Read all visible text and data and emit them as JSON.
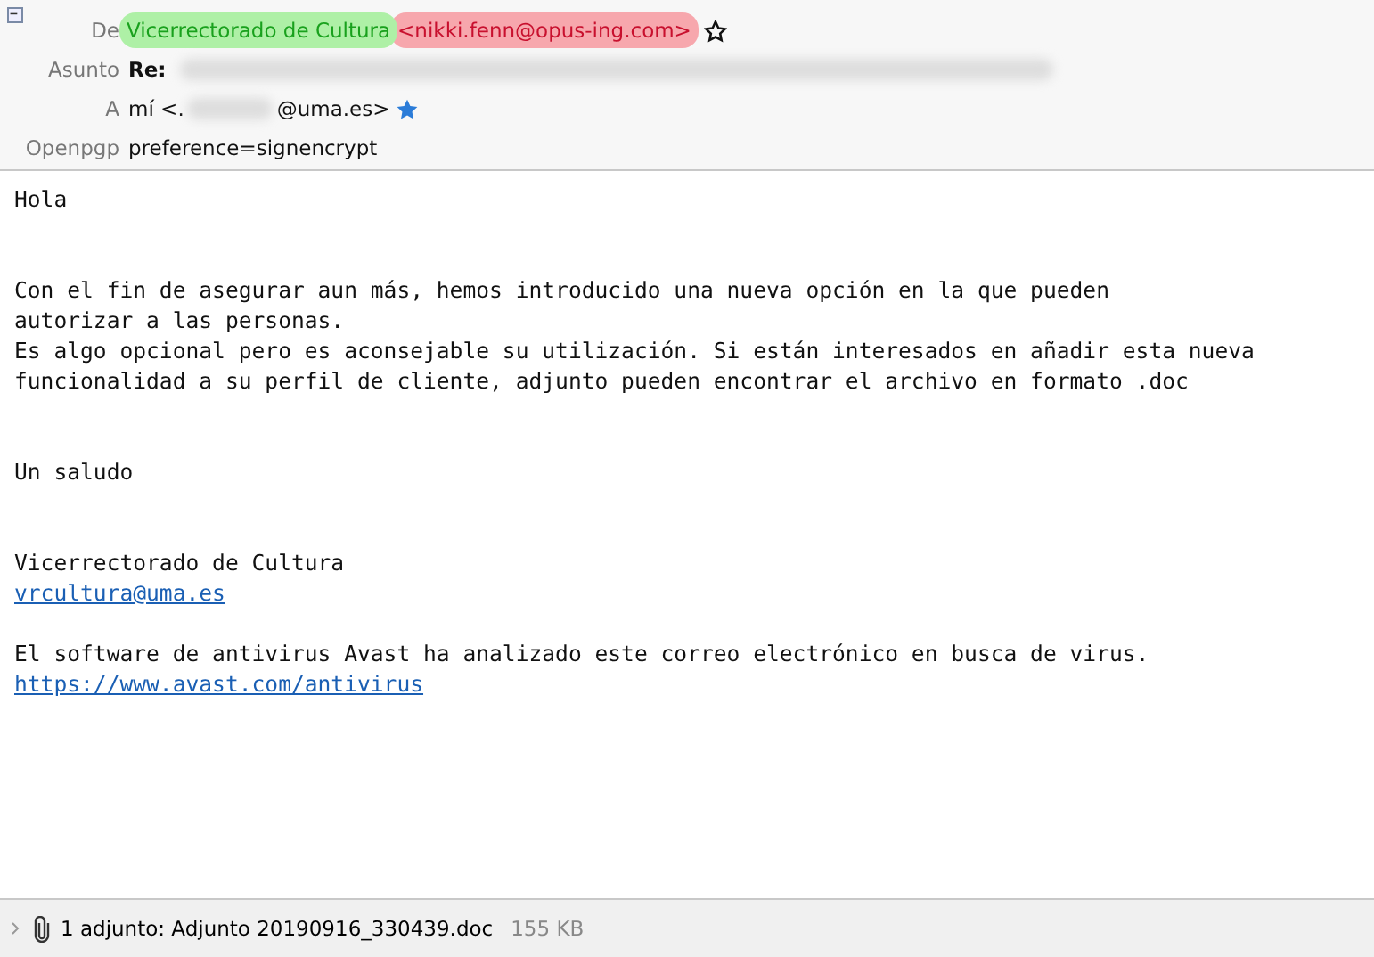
{
  "header": {
    "expanded": true,
    "from": {
      "label": "De",
      "name": "Vicerrectorado de Cultura",
      "address": "<nikki.fenn@opus-ing.com>",
      "starred": false
    },
    "subject": {
      "label": "Asunto",
      "prefix": "Re:"
    },
    "to": {
      "label": "A",
      "prefix": "mí <.",
      "suffix": "@uma.es>",
      "starred": true
    },
    "openpgp": {
      "label": "Openpgp",
      "value": "preference=signencrypt"
    }
  },
  "body": [
    {
      "kind": "text",
      "text": "Hola"
    },
    {
      "kind": "blank"
    },
    {
      "kind": "blank"
    },
    {
      "kind": "text",
      "text": "Con el fin de asegurar aun más, hemos introducido una nueva opción en la que pueden"
    },
    {
      "kind": "text",
      "text": "autorizar a las personas."
    },
    {
      "kind": "text",
      "text": "Es algo opcional pero es aconsejable su utilización. Si están interesados en añadir esta nueva"
    },
    {
      "kind": "text",
      "text": "funcionalidad a su perfil de cliente, adjunto pueden encontrar el archivo en formato .doc"
    },
    {
      "kind": "blank"
    },
    {
      "kind": "blank"
    },
    {
      "kind": "text",
      "text": "Un saludo"
    },
    {
      "kind": "blank"
    },
    {
      "kind": "blank"
    },
    {
      "kind": "text",
      "text": "Vicerrectorado de Cultura"
    },
    {
      "kind": "link",
      "text": "vrcultura@uma.es"
    },
    {
      "kind": "blank"
    },
    {
      "kind": "text",
      "text": "El software de antivirus Avast ha analizado este correo electrónico en busca de virus."
    },
    {
      "kind": "link",
      "text": "https://www.avast.com/antivirus"
    }
  ],
  "attachments": {
    "expanded": false,
    "summary": "1 adjunto: Adjunto 20190916_330439.doc",
    "size": "155 KB"
  }
}
